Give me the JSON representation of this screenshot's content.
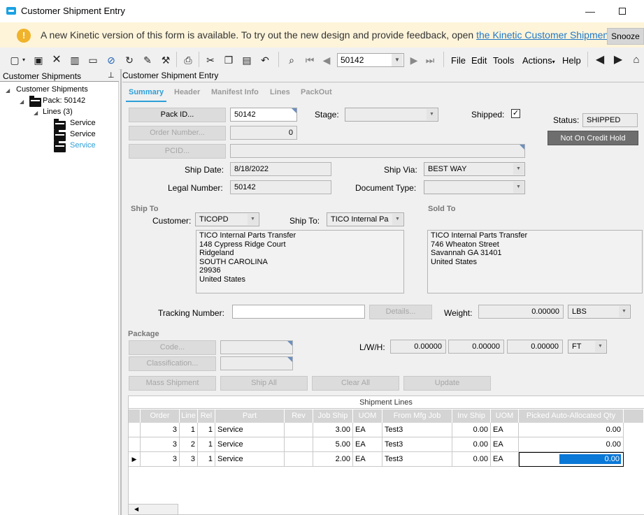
{
  "window": {
    "title": "Customer Shipment Entry"
  },
  "notification": {
    "text": "A new Kinetic version of this form is available. To try out the new design and provide feedback, open ",
    "link": "the Kinetic Customer Shipment Entry a",
    "snooze": "Snooze"
  },
  "toolbar": {
    "record": "50142",
    "menus": [
      "File",
      "Edit",
      "Tools",
      "Actions",
      "Help"
    ]
  },
  "tree": {
    "header": "Customer Shipments",
    "root": "Customer Shipments",
    "pack": "Pack: 50142",
    "lines": "Lines (3)",
    "items": [
      "Service",
      "Service",
      "Service"
    ]
  },
  "main": {
    "header": "Customer Shipment Entry",
    "tabs": [
      "Summary",
      "Header",
      "Manifest Info",
      "Lines",
      "PackOut"
    ]
  },
  "form": {
    "pack_id_btn": "Pack ID...",
    "pack_id": "50142",
    "stage_label": "Stage:",
    "shipped_label": "Shipped:",
    "shipped_check": "✓",
    "status_label": "Status:",
    "status": "SHIPPED",
    "credit_hold": "Not On Credit Hold",
    "order_number_btn": "Order Number...",
    "order_number": "0",
    "pcid_btn": "PCID...",
    "ship_date_label": "Ship Date:",
    "ship_date": "8/18/2022",
    "ship_via_label": "Ship Via:",
    "ship_via": "BEST WAY",
    "legal_number_label": "Legal Number:",
    "legal_number": "50142",
    "doc_type_label": "Document Type:",
    "ship_to_group": "Ship To",
    "customer_label": "Customer:",
    "customer": "TICOPD",
    "ship_to_label": "Ship To:",
    "ship_to": "TICO Internal Pa",
    "ship_to_address": "TICO Internal Parts Transfer\n148 Cypress Ridge Court\nRidgeland\nSOUTH CAROLINA\n29936\nUnited States",
    "sold_to_group": "Sold To",
    "sold_to_address": "TICO Internal Parts Transfer\n746 Wheaton Street\nSavannah GA 31401\nUnited States",
    "tracking_label": "Tracking Number:",
    "details_btn": "Details...",
    "weight_label": "Weight:",
    "weight": "0.00000",
    "weight_uom": "LBS",
    "package_group": "Package",
    "code_btn": "Code...",
    "classification_btn": "Classification...",
    "lwh_label": "L/W/H:",
    "length": "0.00000",
    "width": "0.00000",
    "height": "0.00000",
    "dim_uom": "FT",
    "mass_shipment_btn": "Mass Shipment",
    "ship_all_btn": "Ship All",
    "clear_all_btn": "Clear All",
    "update_btn": "Update"
  },
  "grid": {
    "title": "Shipment Lines",
    "columns": [
      "Order",
      "Line",
      "Rel",
      "Part",
      "Rev",
      "Job Ship",
      "UOM",
      "From Mfg Job",
      "Inv Ship",
      "UOM",
      "Picked Auto-Allocated Qty"
    ],
    "rows": [
      [
        "3",
        "1",
        "1",
        "Service",
        "",
        "3.00",
        "EA",
        "Test3",
        "0.00",
        "EA",
        "0.00"
      ],
      [
        "3",
        "2",
        "1",
        "Service",
        "",
        "5.00",
        "EA",
        "Test3",
        "0.00",
        "EA",
        "0.00"
      ],
      [
        "3",
        "3",
        "1",
        "Service",
        "",
        "2.00",
        "EA",
        "Test3",
        "0.00",
        "EA",
        "0.00"
      ]
    ],
    "current_row_marker": "▶"
  },
  "colors": {
    "accent": "#2d9fd8",
    "selection": "#0a78d7",
    "notify_bg": "#fdf4da"
  }
}
